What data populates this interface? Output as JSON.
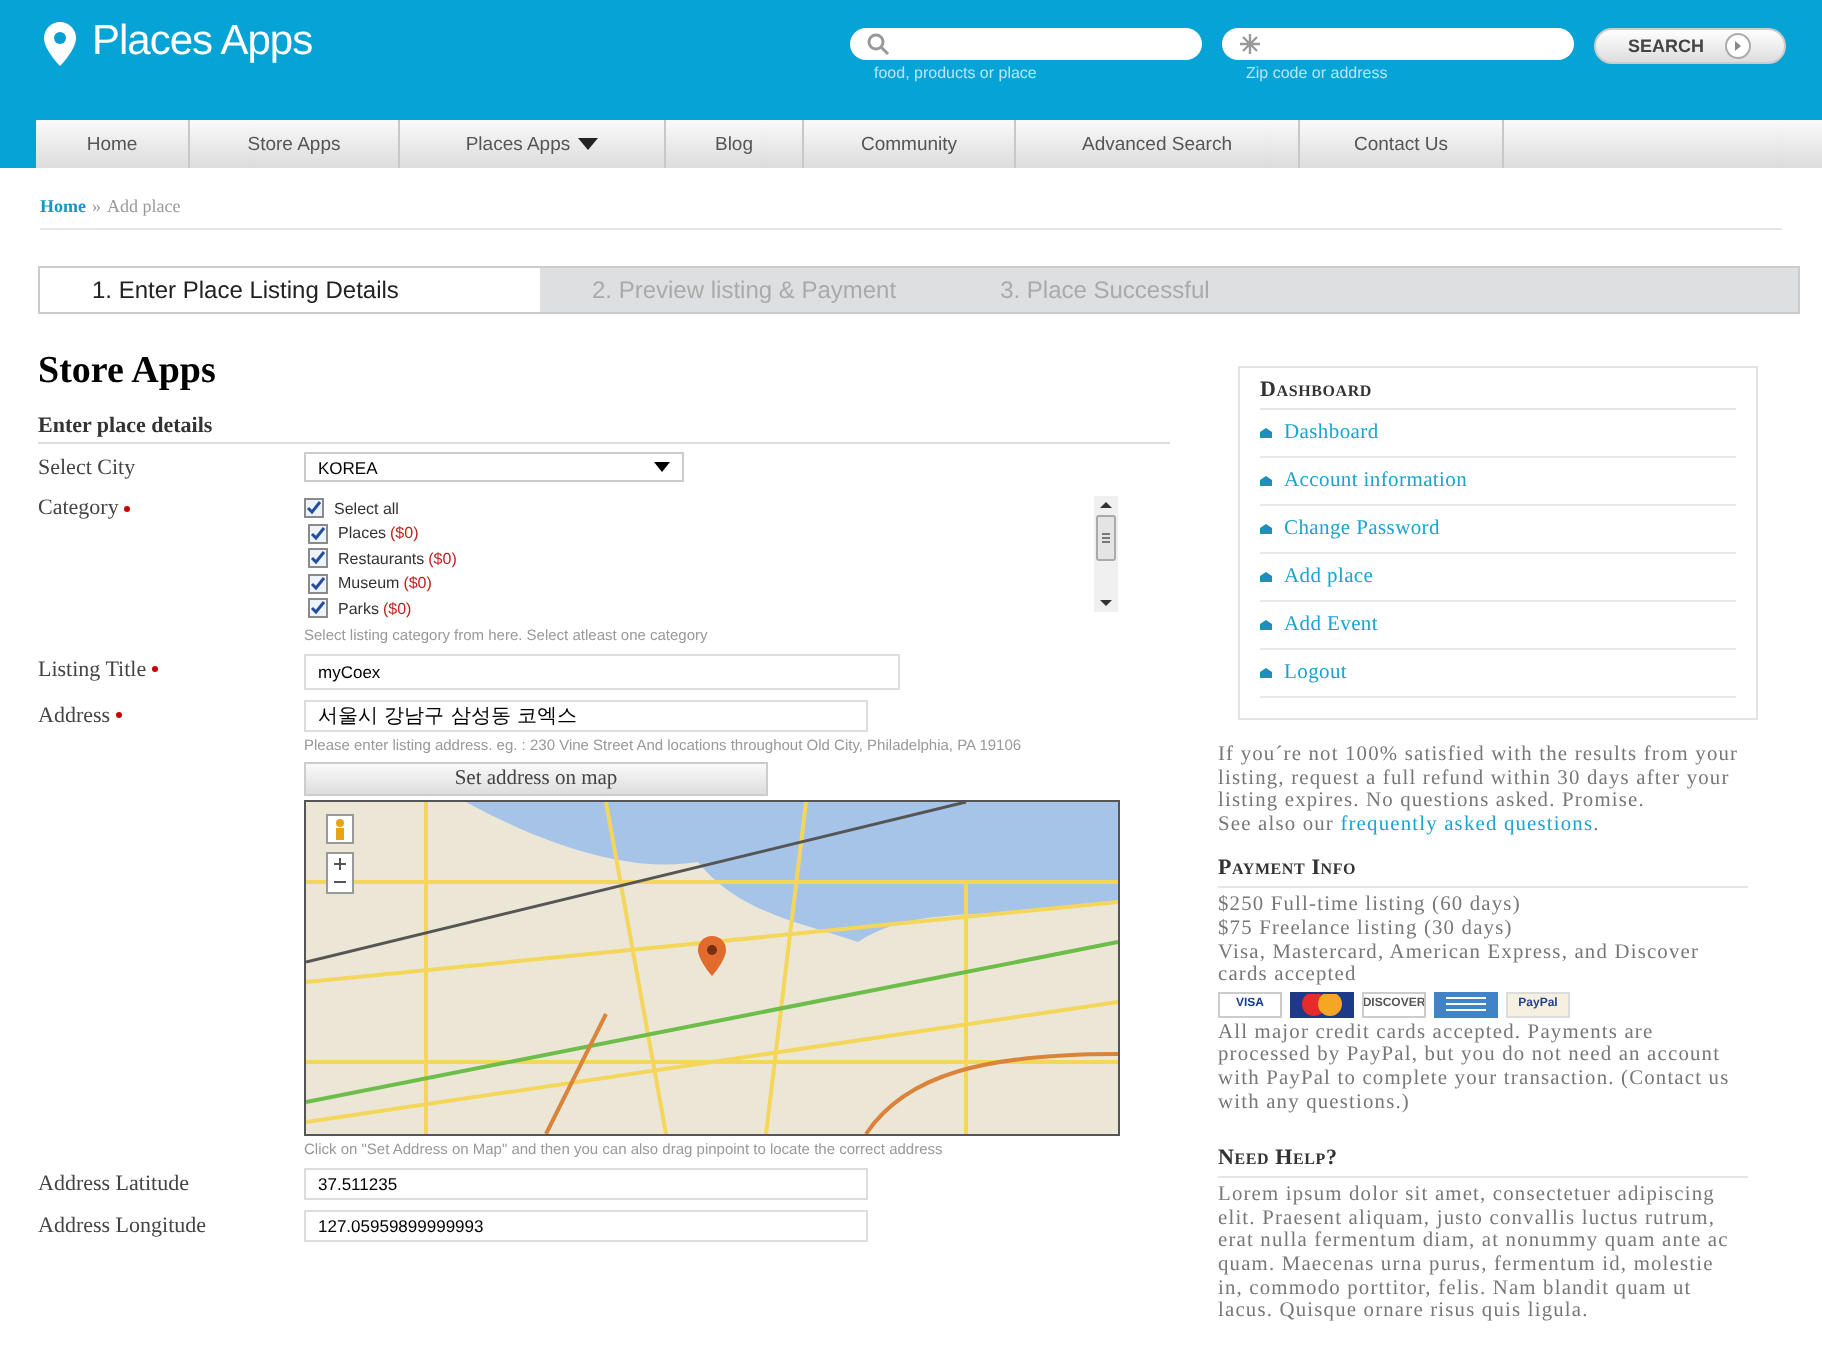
{
  "header": {
    "logo": "Places Apps",
    "search": {
      "hint": "food, products or place"
    },
    "location": {
      "hint": "Zip code or address"
    },
    "search_button": "SEARCH"
  },
  "nav": [
    {
      "label": "Home",
      "dropdown": false
    },
    {
      "label": "Store Apps",
      "dropdown": false
    },
    {
      "label": "Places Apps",
      "dropdown": true
    },
    {
      "label": "Blog",
      "dropdown": false
    },
    {
      "label": "Community",
      "dropdown": false
    },
    {
      "label": "Advanced Search",
      "dropdown": false
    },
    {
      "label": "Contact Us",
      "dropdown": false
    }
  ],
  "breadcrumb": {
    "link": "Home",
    "separator": "»",
    "current": "Add place"
  },
  "steps": [
    {
      "label": "1. Enter Place Listing Details",
      "selected": true
    },
    {
      "label": "2. Preview listing & Payment",
      "selected": false
    },
    {
      "label": "3. Place Successful",
      "selected": false
    }
  ],
  "form": {
    "title": "Store Apps",
    "section": "Enter place details",
    "city": {
      "label": "Select City",
      "value": "KOREA"
    },
    "category": {
      "label": "Category",
      "required": true,
      "items": [
        {
          "label": "Select all",
          "checked": true
        },
        {
          "label": "Places",
          "price": "($0)",
          "checked": true
        },
        {
          "label": "Restaurants",
          "price": "($0)",
          "checked": true
        },
        {
          "label": "Museum",
          "price": "($0)",
          "checked": true
        },
        {
          "label": "Parks",
          "price": "($0)",
          "checked": true
        }
      ],
      "hint": "Select listing category from here. Select atleast one category"
    },
    "listing_title": {
      "label": "Listing Title",
      "required": true,
      "value": "myCoex"
    },
    "address": {
      "label": "Address",
      "required": true,
      "value": "서울시 강남구 삼성동 코엑스",
      "hint": "Please enter listing address. eg. : 230 Vine Street And locations throughout Old City, Philadelphia, PA 19106"
    },
    "map_button": "Set address on map",
    "map_hint": "Click on \"Set Address on Map\" and then you can also drag pinpoint to locate the correct address",
    "latitude": {
      "label": "Address Latitude",
      "value": "37.511235"
    },
    "longitude": {
      "label": "Address Longitude",
      "value": "127.05959899999993"
    }
  },
  "sidebar": {
    "dashboard": {
      "title": "Dashboard",
      "items": [
        "Dashboard",
        "Account information",
        "Change Password",
        "Add place",
        "Add Event",
        "Logout"
      ]
    },
    "guarantee": "If you´re not 100% satisfied with the results from your listing, request a full refund within 30 days after your listing expires. No questions asked. Promise.",
    "faq_prefix": "See also our",
    "faq_link": "frequently asked questions",
    "faq_suffix": ".",
    "payment": {
      "title": "Payment Info",
      "lines": [
        "$250 Full-time listing (60 days)",
        "$75 Freelance listing (30 days)",
        "Visa, Mastercard, American Express, and Discover cards accepted"
      ],
      "cards": [
        {
          "kind": "visa",
          "label": "VISA"
        },
        {
          "kind": "mastercard"
        },
        {
          "kind": "discover",
          "label": "DISCOVER"
        },
        {
          "kind": "amex"
        },
        {
          "kind": "paypal",
          "label": "PayPal"
        }
      ],
      "note": "All major credit cards accepted. Payments are processed by PayPal, but you do not need an account with PayPal to complete your transaction. (Contact us with any questions.)"
    },
    "help": {
      "title": "Need Help?",
      "text": "Lorem ipsum dolor sit amet, consectetuer adipiscing elit. Praesent aliquam, justo convallis luctus rutrum, erat nulla fermentum diam, at nonummy quam ante ac quam. Maecenas urna purus, fermentum id, molestie in, commodo porttitor, felis. Nam blandit quam ut lacus. Quisque ornare risus quis ligula."
    }
  }
}
